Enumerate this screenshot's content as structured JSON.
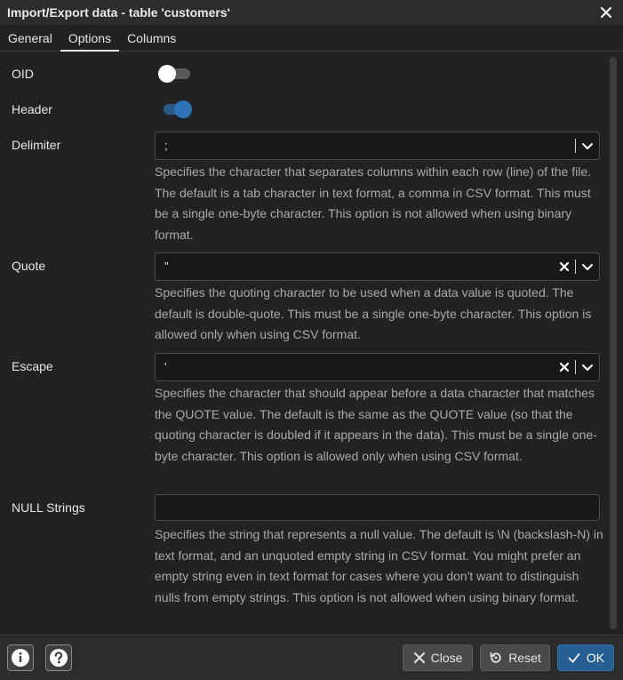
{
  "window": {
    "title": "Import/Export data - table 'customers'",
    "close_icon": "close-icon"
  },
  "tabs": [
    {
      "label": "General",
      "active": false
    },
    {
      "label": "Options",
      "active": true
    },
    {
      "label": "Columns",
      "active": false
    }
  ],
  "options": {
    "oid": {
      "label": "OID",
      "enabled": false
    },
    "header": {
      "label": "Header",
      "enabled": true
    },
    "delimiter": {
      "label": "Delimiter",
      "value": ";",
      "clearable": false,
      "help": "Specifies the character that separates columns within each row (line) of the file. The default is a tab character in text format, a comma in CSV format. This must be a single one-byte character. This option is not allowed when using binary format."
    },
    "quote": {
      "label": "Quote",
      "value": "\"",
      "clearable": true,
      "help": "Specifies the quoting character to be used when a data value is quoted. The default is double-quote. This must be a single one-byte character. This option is allowed only when using CSV format."
    },
    "escape": {
      "label": "Escape",
      "value": "'",
      "clearable": true,
      "help": "Specifies the character that should appear before a data character that matches the QUOTE value. The default is the same as the QUOTE value (so that the quoting character is doubled if it appears in the data). This must be a single one-byte character. This option is allowed only when using CSV format."
    },
    "null_strings": {
      "label": "NULL Strings",
      "value": "",
      "help": "Specifies the string that represents a null value. The default is \\N (backslash-N) in text format, and an unquoted empty string in CSV format. You might prefer an empty string even in text format for cases where you don't want to distinguish nulls from empty strings. This option is not allowed when using binary format."
    }
  },
  "footer": {
    "info_icon": "info-icon",
    "help_icon": "help-icon",
    "close_label": "Close",
    "reset_label": "Reset",
    "ok_label": "OK"
  },
  "colors": {
    "background": "#222222",
    "accent": "#265f94",
    "toggle_on": "#2c73b8"
  }
}
